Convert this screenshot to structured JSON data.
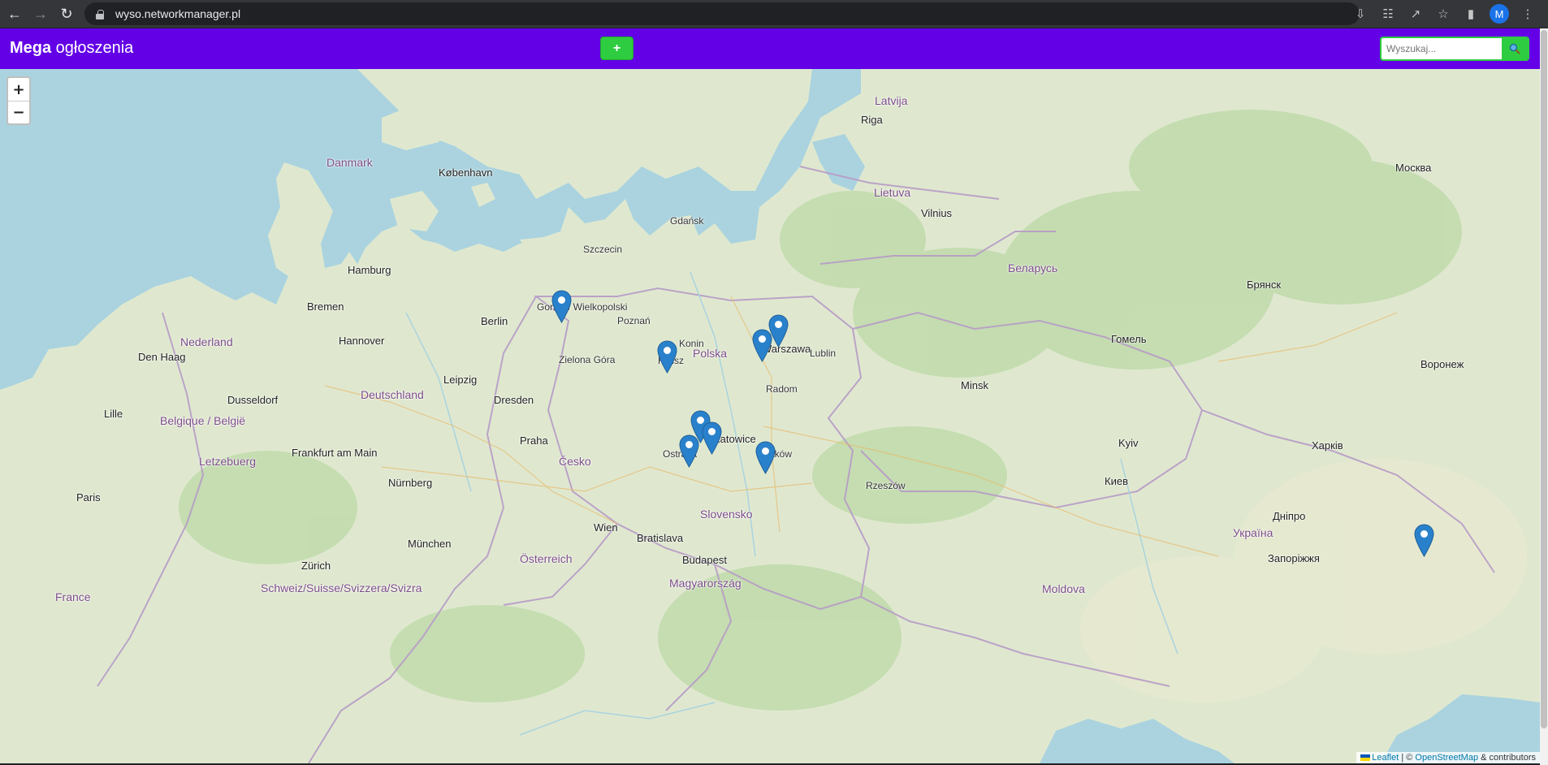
{
  "browser": {
    "url": "wyso.networkmanager.pl",
    "avatar_letter": "M"
  },
  "navbar": {
    "brand_bold": "Mega",
    "brand_rest": " ogłoszenia",
    "add_label": "+",
    "search_placeholder": "Wyszukaj...",
    "colors": {
      "navbar": "#6300e6",
      "button": "#2ecc40"
    }
  },
  "map": {
    "zoom_in": "+",
    "zoom_out": "−",
    "attribution": {
      "leaflet": "Leaflet",
      "sep": " | © ",
      "osm": "OpenStreetMap",
      "rest": " & contributors"
    },
    "marker_count": 10,
    "labels": {
      "countries": [
        "Danmark",
        "Polska",
        "Lietuva",
        "Latvija",
        "Беларусь",
        "Україна",
        "Deutschland",
        "Česko",
        "Slovensko",
        "Magyarország",
        "Österreich",
        "Nederland",
        "Belgique / België",
        "Letzebuerg",
        "Schweiz/Suisse/Svizzera/Svizra",
        "France",
        "Moldova"
      ],
      "cities": [
        "Warszawa",
        "Berlin",
        "København",
        "Hamburg",
        "Praha",
        "Wien",
        "Bratislava",
        "Budapest",
        "Minsk",
        "Kyiv",
        "Vilnius",
        "Riga",
        "Rzeszów",
        "Kraków",
        "Katowice",
        "Ostrava",
        "Konin",
        "Radom",
        "Lublin",
        "Kalisz",
        "Gorzów Wielkopolski",
        "Zielona Góra",
        "Poznań",
        "Gdańsk",
        "Szczecin",
        "Bremen",
        "Hannover",
        "Leipzig",
        "Dresden",
        "München",
        "Nürnberg",
        "Frankfurt am Main",
        "Paris",
        "Dusseldorf",
        "Lille",
        "Den Haag",
        "Zürich",
        "Москва",
        "Киев",
        "Харків",
        "Дніпро",
        "Запоріжжя",
        "Гомель",
        "Брянск",
        "Воронеж"
      ]
    }
  }
}
